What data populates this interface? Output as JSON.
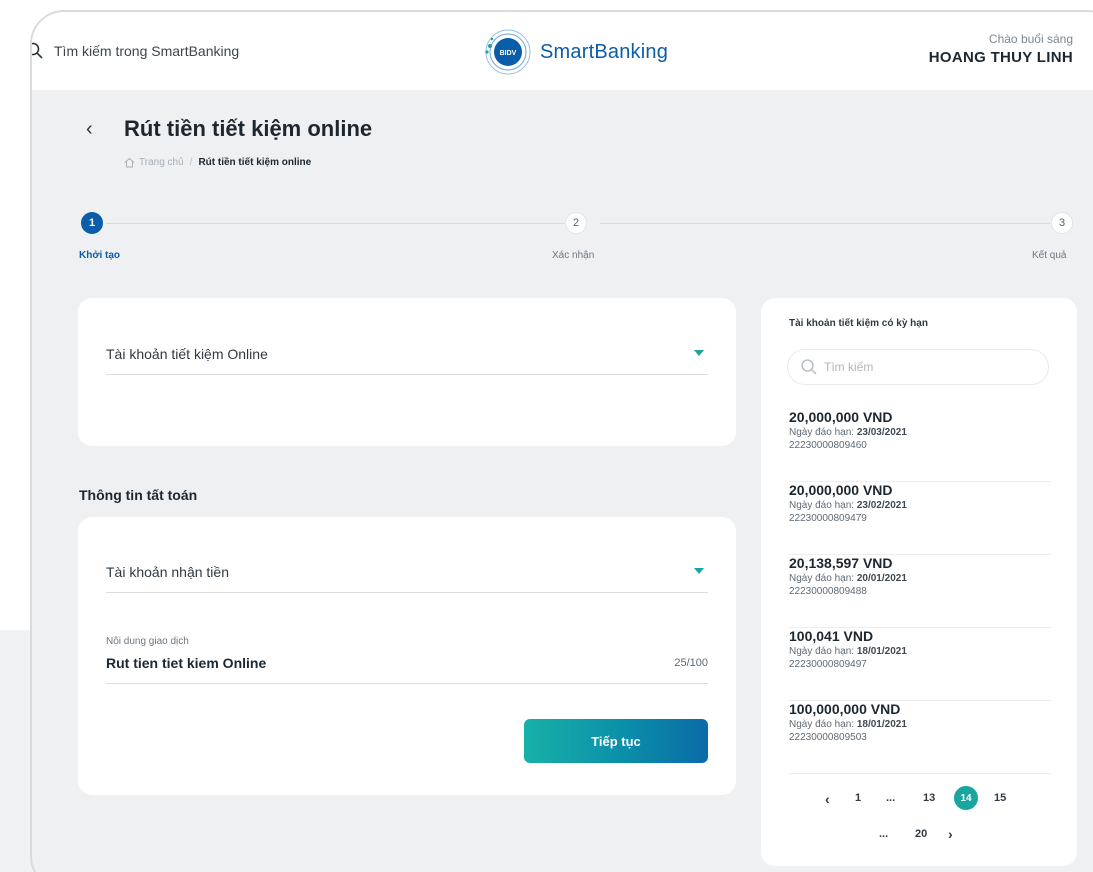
{
  "header": {
    "search_placeholder": "Tìm kiếm trong SmartBanking",
    "logo_badge": "BIDV",
    "logo_text": "SmartBanking",
    "greeting": "Chào buổi sáng",
    "user_name": "HOANG THUY LINH"
  },
  "page": {
    "title": "Rút tiền tiết kiệm online",
    "breadcrumb": {
      "home": "Trang chủ",
      "separator": "/",
      "current": "Rút tiền tiết kiệm online"
    }
  },
  "stepper": {
    "steps": [
      {
        "number": "1",
        "label": "Khởi tạo"
      },
      {
        "number": "2",
        "label": "Xác nhận"
      },
      {
        "number": "3",
        "label": "Kết quả"
      }
    ],
    "active_step": 1
  },
  "form": {
    "savings_account_placeholder": "Tài khoản tiết kiệm Online",
    "section_title": "Thông tin tất toán",
    "receiving_account_placeholder": "Tài khoản nhận tiền",
    "description_label": "Nội dung giao dịch",
    "description_value": "Rut tien tiet kiem Online",
    "description_counter": "25/100",
    "continue_label": "Tiếp tục"
  },
  "accounts_panel": {
    "title": "Tài khoản tiết kiệm có kỳ hạn",
    "search_placeholder": "Tìm kiếm",
    "date_prefix": "Ngày đáo hạn:",
    "items": [
      {
        "amount": "20,000,000 VND",
        "due_date": "23/03/2021",
        "number": "22230000809460"
      },
      {
        "amount": "20,000,000 VND",
        "due_date": "23/02/2021",
        "number": "22230000809479"
      },
      {
        "amount": "20,138,597 VND",
        "due_date": "20/01/2021",
        "number": "22230000809488"
      },
      {
        "amount": "100,041 VND",
        "due_date": "18/01/2021",
        "number": "22230000809497"
      },
      {
        "amount": "100,000,000 VND",
        "due_date": "18/01/2021",
        "number": "22230000809503"
      }
    ],
    "pagination": {
      "prev": "‹",
      "row1": [
        "1",
        "...",
        "13",
        "14",
        "15"
      ],
      "row2": [
        "...",
        "20"
      ],
      "next": "›",
      "current": "14"
    }
  },
  "colors": {
    "primary_blue": "#0a5da8",
    "teal_accent": "#1aa6a0",
    "background": "#eef0f2"
  }
}
